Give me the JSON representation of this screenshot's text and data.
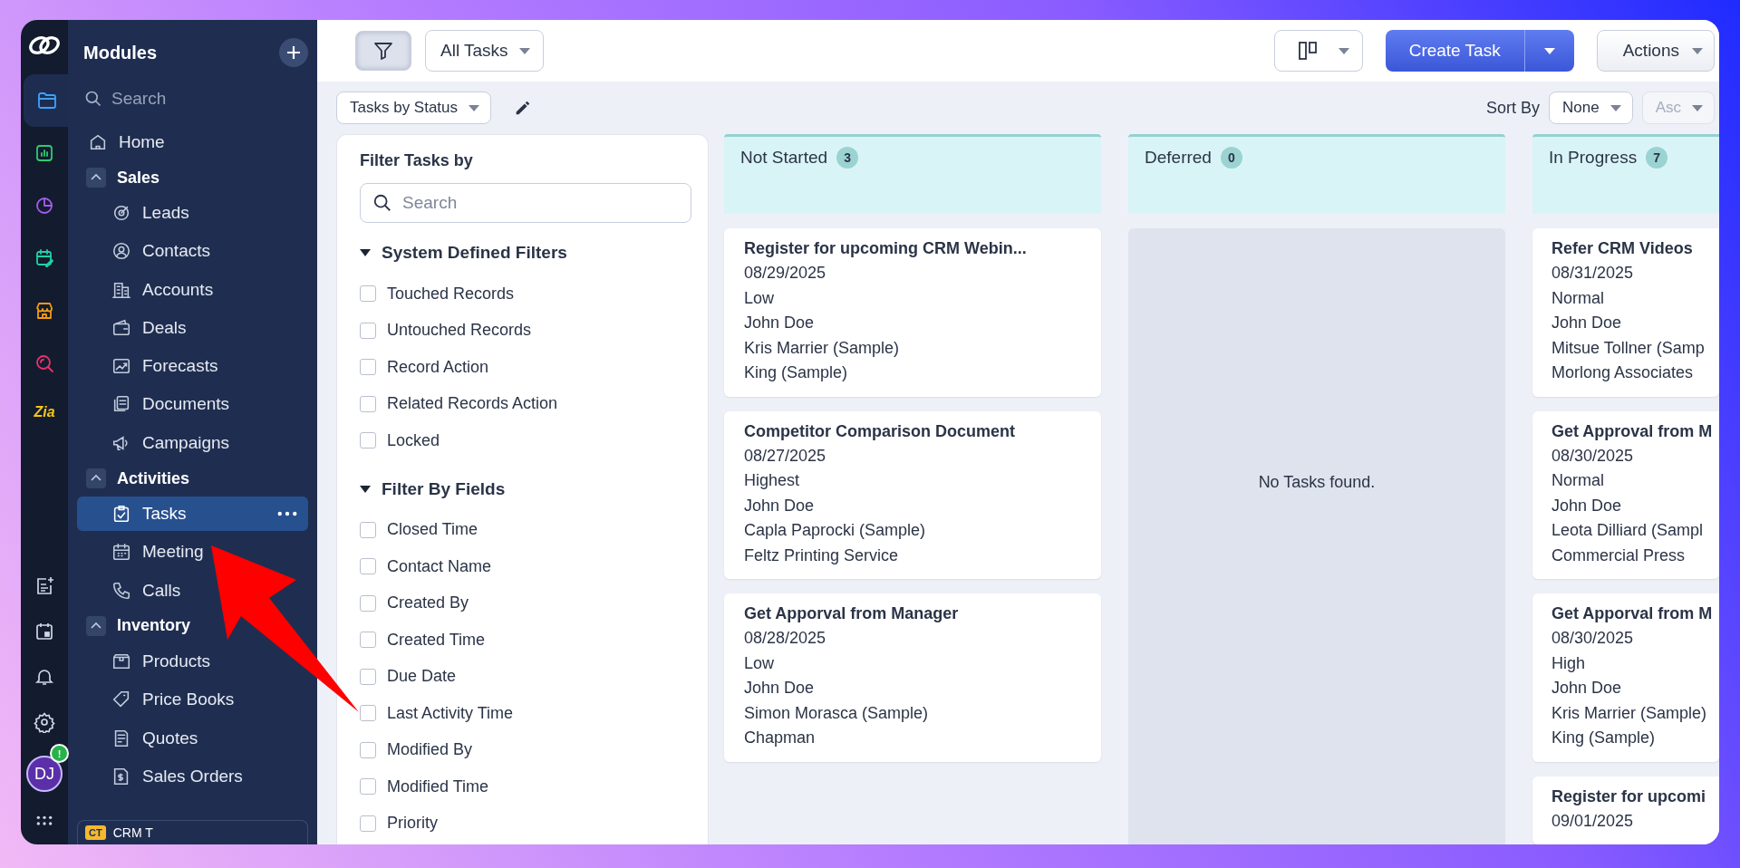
{
  "rail": {
    "items": [
      {
        "selected": true
      },
      {
        "selected": false
      },
      {
        "selected": false
      },
      {
        "selected": false
      },
      {
        "selected": false
      },
      {
        "selected": false
      }
    ],
    "zia": "Zia",
    "avatar": {
      "initials": "DJ",
      "badge": "!"
    }
  },
  "sidebar": {
    "title": "Modules",
    "search": {
      "placeholder": "Search"
    },
    "items": [
      {
        "label": "Home",
        "selected": false
      },
      {
        "label": "Sales",
        "expanded": true,
        "children": [
          {
            "label": "Leads",
            "selected": false
          },
          {
            "label": "Contacts",
            "selected": false
          },
          {
            "label": "Accounts",
            "selected": false
          },
          {
            "label": "Deals",
            "selected": false
          },
          {
            "label": "Forecasts",
            "selected": false
          },
          {
            "label": "Documents",
            "selected": false
          },
          {
            "label": "Campaigns",
            "selected": false
          }
        ]
      },
      {
        "label": "Activities",
        "expanded": true,
        "children": [
          {
            "label": "Tasks",
            "selected": true
          },
          {
            "label": "Meeting",
            "selected": false
          },
          {
            "label": "Calls",
            "selected": false
          }
        ]
      },
      {
        "label": "Inventory",
        "expanded": true,
        "children": [
          {
            "label": "Products",
            "selected": false
          },
          {
            "label": "Price Books",
            "selected": false
          },
          {
            "label": "Quotes",
            "selected": false
          },
          {
            "label": "Sales Orders",
            "selected": false
          }
        ]
      }
    ],
    "workspace": {
      "badge": "CT",
      "name": "CRM T"
    }
  },
  "toolbar": {
    "filter_pressed": true,
    "view": "All Tasks",
    "create": "Create Task",
    "actions": "Actions"
  },
  "subbar": {
    "layout": "Tasks by Status",
    "sort_label": "Sort By",
    "sort_value": "None",
    "order": "Asc",
    "order_disabled": true
  },
  "filter_panel": {
    "title": "Filter Tasks by",
    "search": {
      "placeholder": "Search"
    },
    "sections": [
      {
        "title": "System Defined Filters",
        "expanded": true,
        "options": [
          {
            "label": "Touched Records",
            "checked": false
          },
          {
            "label": "Untouched Records",
            "checked": false
          },
          {
            "label": "Record Action",
            "checked": false
          },
          {
            "label": "Related Records Action",
            "checked": false
          },
          {
            "label": "Locked",
            "checked": false
          }
        ]
      },
      {
        "title": "Filter By Fields",
        "expanded": true,
        "options": [
          {
            "label": "Closed Time",
            "checked": false
          },
          {
            "label": "Contact Name",
            "checked": false
          },
          {
            "label": "Created By",
            "checked": false
          },
          {
            "label": "Created Time",
            "checked": false
          },
          {
            "label": "Due Date",
            "checked": false
          },
          {
            "label": "Last Activity Time",
            "checked": false
          },
          {
            "label": "Modified By",
            "checked": false
          },
          {
            "label": "Modified Time",
            "checked": false
          },
          {
            "label": "Priority",
            "checked": false
          }
        ]
      }
    ]
  },
  "columns": [
    {
      "title": "Not Started",
      "count": "3",
      "cards": [
        {
          "title": "Register for upcoming CRM Webin...",
          "lines": [
            "08/29/2025",
            "Low",
            "John Doe",
            "Kris Marrier (Sample)",
            "King (Sample)"
          ]
        },
        {
          "title": "Competitor Comparison Document",
          "lines": [
            "08/27/2025",
            "Highest",
            "John Doe",
            "Capla Paprocki (Sample)",
            "Feltz Printing Service"
          ]
        },
        {
          "title": "Get Apporval from Manager",
          "lines": [
            "08/28/2025",
            "Low",
            "John Doe",
            "Simon Morasca (Sample)",
            "Chapman"
          ]
        }
      ]
    },
    {
      "title": "Deferred",
      "count": "0",
      "empty_text": "No Tasks found."
    },
    {
      "title": "In Progress",
      "count": "7",
      "cards": [
        {
          "title": "Refer CRM Videos",
          "lines": [
            "08/31/2025",
            "Normal",
            "John Doe",
            "Mitsue Tollner (Samp",
            "Morlong Associates"
          ]
        },
        {
          "title": "Get Approval from M",
          "lines": [
            "08/30/2025",
            "Normal",
            "John Doe",
            "Leota Dilliard (Sampl",
            "Commercial Press"
          ]
        },
        {
          "title": "Get Apporval from M",
          "lines": [
            "08/30/2025",
            "High",
            "John Doe",
            "Kris Marrier (Sample)",
            "King (Sample)"
          ]
        },
        {
          "title": "Register for upcomi",
          "lines": [
            "09/01/2025"
          ]
        }
      ]
    }
  ]
}
